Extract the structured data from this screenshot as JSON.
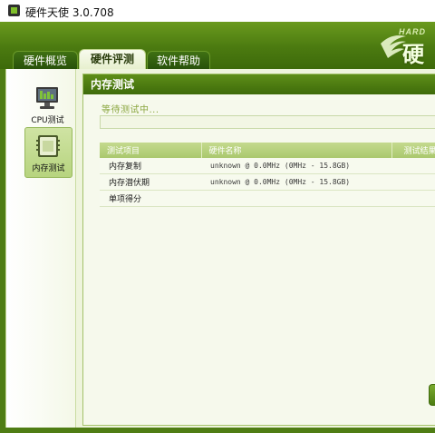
{
  "window": {
    "title": "硬件天使 3.0.708"
  },
  "logo": {
    "top_text": "HARD",
    "main_text": "硬"
  },
  "tabs": [
    {
      "label": "硬件概览",
      "active": false
    },
    {
      "label": "硬件评测",
      "active": true
    },
    {
      "label": "软件帮助",
      "active": false
    }
  ],
  "sidebar": {
    "items": [
      {
        "label": "CPU测试",
        "icon": "monitor-icon",
        "active": false
      },
      {
        "label": "内存测试",
        "icon": "memory-chip-icon",
        "active": true
      }
    ]
  },
  "panel": {
    "title": "内存测试",
    "status": "等待测试中...",
    "progress": 0
  },
  "table": {
    "columns": [
      "测试项目",
      "硬件名称",
      "测试结果"
    ],
    "rows": [
      {
        "item": "内存复制",
        "hardware": "unknown @ 0.0MHz (0MHz - 15.8GB)",
        "result": ""
      },
      {
        "item": "内存潜伏期",
        "hardware": "unknown @ 0.0MHz (0MHz - 15.8GB)",
        "result": ""
      },
      {
        "item": "单项得分",
        "hardware": "",
        "result": ""
      }
    ]
  },
  "colors": {
    "header_green": "#4b7a10",
    "panel_bg": "#f6f9ec",
    "status_text": "#8aa63f"
  }
}
